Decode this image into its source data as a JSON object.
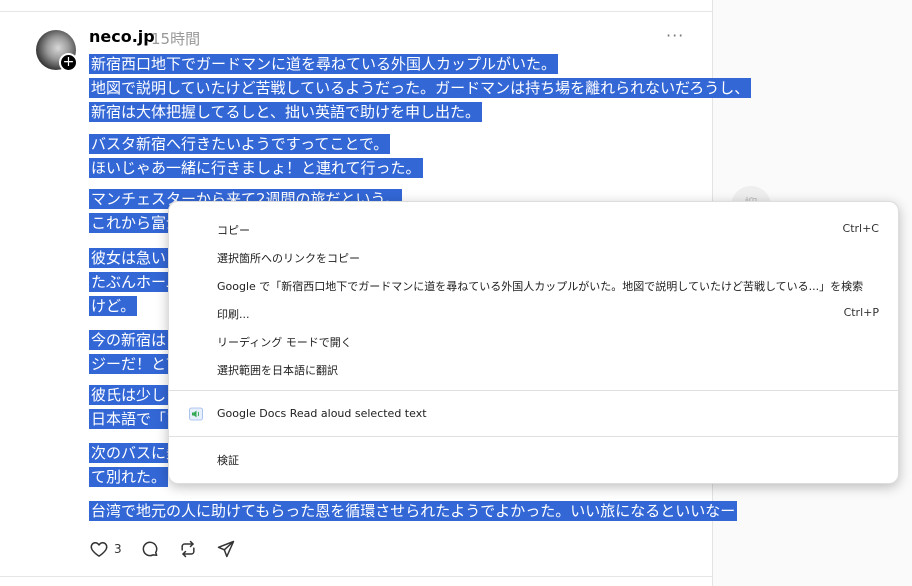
{
  "post": {
    "username": "neco.jp",
    "timestamp": "15時間",
    "more": "···",
    "paragraphs": [
      [
        "新宿西口地下でガードマンに道を尋ねている外国人カップルがいた。",
        "地図で説明していたけど苦戦しているようだった。ガードマンは持ち場を離れられないだろうし、",
        "新宿は大体把握してるしと、拙い英語で助けを申し出た。"
      ],
      [
        "バスタ新宿へ行きたいようですってことで。",
        "ほいじゃあ一緒に行きましょ！と連れて行った。"
      ],
      [
        "マンチェスターから来て2週間の旅だという。",
        "これから富士"
      ],
      [
        "彼女は急い",
        "たぶんホーム",
        "けど。"
      ],
      [
        "今の新宿は",
        "ジーだ！と言"
      ],
      [
        "彼氏は少し",
        "日本語で「ア"
      ],
      [
        "次のバスに乗",
        "て別れた。"
      ],
      [
        "台湾で地元の人に助けてもらった恩を循環させられたようでよかった。いい旅になるといいなー"
      ]
    ],
    "like_count": "3"
  },
  "side_bubble": "抑",
  "context_menu": {
    "items": [
      {
        "label": "コピー",
        "shortcut": "Ctrl+C"
      },
      {
        "label": "選択箇所へのリンクをコピー",
        "shortcut": ""
      },
      {
        "label": "Google で「新宿西口地下でガードマンに道を尋ねている外国人カップルがいた。地図で説明していたけど苦戦している...」を検索",
        "shortcut": ""
      },
      {
        "label": "印刷...",
        "shortcut": "Ctrl+P"
      },
      {
        "label": "リーディング モードで開く",
        "shortcut": ""
      },
      {
        "label": "選択範囲を日本語に翻訳",
        "shortcut": ""
      }
    ],
    "extension_item": {
      "label": "Google Docs Read aloud selected text",
      "icon": "speaker-icon"
    },
    "inspect": {
      "label": "検証"
    }
  },
  "colors": {
    "selection": "#3367d6",
    "timestamp": "#999999",
    "ext_icon": "#34a853"
  }
}
